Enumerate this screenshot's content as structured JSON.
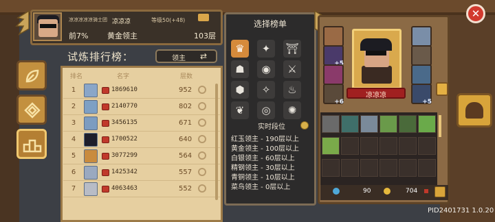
{
  "header": {
    "guild": "凉凉凉凉凉骑士团",
    "name": "凉凉凉",
    "level": "等级50(+48)",
    "percent": "前7%",
    "rank_title": "黄金领主",
    "floor": "103层"
  },
  "leaderboard": {
    "title": "试炼排行榜：",
    "filter_label": "领主",
    "columns": [
      "排名",
      "名字",
      "层数"
    ],
    "rows": [
      {
        "rank": "1",
        "id": "1869610",
        "floor": "952"
      },
      {
        "rank": "2",
        "id": "2140770",
        "floor": "802"
      },
      {
        "rank": "3",
        "id": "3456135",
        "floor": "671"
      },
      {
        "rank": "4",
        "id": "1700522",
        "floor": "640"
      },
      {
        "rank": "5",
        "id": "3077299",
        "floor": "564"
      },
      {
        "rank": "6",
        "id": "1425342",
        "floor": "557"
      },
      {
        "rank": "7",
        "id": "4063463",
        "floor": "552"
      }
    ]
  },
  "popup": {
    "title": "选择榜单",
    "icons": [
      "crown-icon",
      "star-icon",
      "gate-icon",
      "arch-icon",
      "swirl-icon",
      "claws-icon",
      "hexagon-icon",
      "diamond-star-icon",
      "flame-icon",
      "wings-icon",
      "vortex-icon",
      "sun-swirl-icon"
    ],
    "realtime_header": "实时段位",
    "tiers": [
      "红玉领主 - 190层以上",
      "黄金领主 - 100层以上",
      "白银领主 - 60层以上",
      "精钢领主 - 30层以上",
      "青铜领主 - 10层以上",
      "菜鸟领主 - 0层以上"
    ]
  },
  "team": {
    "hero_name": "凉凉凉",
    "left_slots": [
      "",
      "+5",
      "",
      "+6"
    ],
    "right_slots": [
      "",
      "",
      "",
      "+5"
    ],
    "gems": "90",
    "coins": "704"
  },
  "footer": {
    "pid": "PID2401731 1.0.20"
  },
  "colors": {
    "panel_bg": "#e6cfa0",
    "popup_bg": "#2c2b2b",
    "accent_gold": "#d8a43a",
    "close_red": "#d23a2e",
    "hero_name_red": "#a02020"
  }
}
